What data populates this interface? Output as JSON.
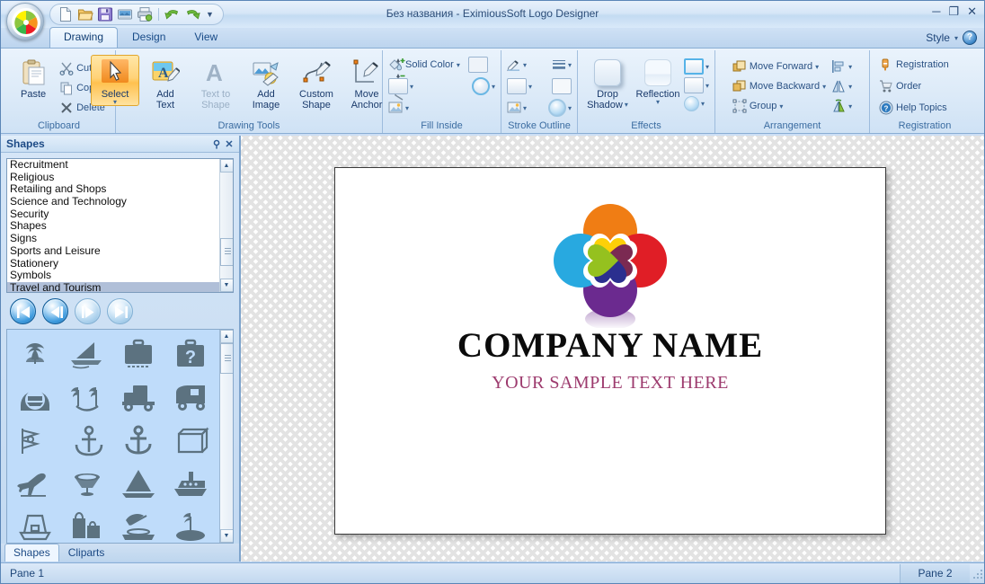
{
  "window": {
    "title": "Без названия - EximiousSoft Logo Designer",
    "minimize": "─",
    "maximize": "❐",
    "close": "✕"
  },
  "quick_access": {
    "items": [
      {
        "name": "new-document-icon",
        "tip": "New"
      },
      {
        "name": "open-folder-icon",
        "tip": "Open"
      },
      {
        "name": "save-disk-icon",
        "tip": "Save"
      },
      {
        "name": "export-image-icon",
        "tip": "Export"
      },
      {
        "name": "print-icon",
        "tip": "Print"
      },
      {
        "name": "undo-icon",
        "tip": "Undo"
      },
      {
        "name": "redo-icon",
        "tip": "Redo"
      }
    ],
    "customize_caret": "▼"
  },
  "ribbon": {
    "tabs": [
      {
        "label": "Drawing",
        "active": true
      },
      {
        "label": "Design",
        "active": false
      },
      {
        "label": "View",
        "active": false
      }
    ],
    "style_label": "Style",
    "style_caret": "▾",
    "help_glyph": "?",
    "groups": [
      {
        "title": "Clipboard",
        "paste_label": "Paste",
        "items": [
          {
            "label": "Cut",
            "icon": "scissors-icon"
          },
          {
            "label": "Copy",
            "icon": "copy-icon"
          },
          {
            "label": "Delete",
            "icon": "delete-x-icon"
          }
        ]
      },
      {
        "title": "Drawing Tools",
        "buttons": [
          {
            "label_top": "Select",
            "label_bottom": "",
            "icon": "cursor-arrow-icon",
            "selected": true,
            "has_caret": true,
            "disabled": false
          },
          {
            "label_top": "Add",
            "label_bottom": "Text",
            "icon": "add-text-icon",
            "selected": false,
            "has_caret": false,
            "disabled": false
          },
          {
            "label_top": "Text to",
            "label_bottom": "Shape",
            "icon": "text-to-shape-icon",
            "selected": false,
            "has_caret": false,
            "disabled": true
          },
          {
            "label_top": "Add",
            "label_bottom": "Image",
            "icon": "add-image-icon",
            "selected": false,
            "has_caret": false,
            "disabled": false
          },
          {
            "label_top": "Custom",
            "label_bottom": "Shape",
            "icon": "custom-shape-icon",
            "selected": false,
            "has_caret": false,
            "disabled": false
          },
          {
            "label_top": "Move",
            "label_bottom": "Anchor",
            "icon": "move-anchor-icon",
            "selected": false,
            "has_caret": false,
            "disabled": false
          }
        ],
        "mini_tools": [
          {
            "icon": "add-anchor-icon"
          },
          {
            "icon": "remove-anchor-icon"
          },
          {
            "icon": "corner-anchor-icon"
          }
        ]
      },
      {
        "title": "Fill Inside",
        "fill_type_label": "Solid Color",
        "fill_caret": "▾",
        "rows": [
          {
            "icon": "paint-bucket-icon",
            "label": "Solid Color"
          },
          {
            "icon": "gradient-swatch-icon",
            "label": ""
          },
          {
            "icon": "texture-image-icon",
            "label": ""
          }
        ]
      },
      {
        "title": "Stroke Outline",
        "rows": [
          {
            "icon": "pen-outline-icon"
          },
          {
            "icon": "line-weight-icon"
          },
          {
            "icon": "stroke-color-icon"
          },
          {
            "icon": "stroke-texture-icon"
          }
        ]
      },
      {
        "title": "Effects",
        "buttons": [
          {
            "label_top": "Drop",
            "label_bottom": "Shadow",
            "icon": "drop-shadow-icon",
            "has_caret": true
          },
          {
            "label_top": "Reflection",
            "label_bottom": "",
            "icon": "reflection-icon",
            "has_caret": true
          }
        ],
        "mini": [
          {
            "icon": "glow-effect-icon"
          },
          {
            "icon": "bevel-effect-icon"
          },
          {
            "icon": "soft-edge-icon"
          }
        ]
      },
      {
        "title": "Arrangement",
        "items": [
          {
            "label": "Move Forward",
            "icon": "move-forward-icon",
            "caret": "▾"
          },
          {
            "label": "Move Backward",
            "icon": "move-backward-icon",
            "caret": "▾"
          },
          {
            "label": "Group",
            "icon": "group-icon",
            "caret": "▾"
          }
        ],
        "mini": [
          {
            "icon": "align-icon",
            "caret": "▾"
          },
          {
            "icon": "flip-horizontal-icon",
            "caret": "▾"
          },
          {
            "icon": "rotate-icon",
            "caret": "▾"
          }
        ]
      },
      {
        "title": "Registration",
        "items": [
          {
            "label": "Registration",
            "icon": "registration-key-icon"
          },
          {
            "label": "Order",
            "icon": "shopping-cart-icon"
          },
          {
            "label": "Help Topics",
            "icon": "help-circle-icon"
          }
        ]
      }
    ]
  },
  "shapes_panel": {
    "title": "Shapes",
    "pin_glyph": "⚲",
    "close_glyph": "✕",
    "categories": [
      "Recruitment",
      "Religious",
      "Retailing and Shops",
      "Science and Technology",
      "Security",
      "Shapes",
      "Signs",
      "Sports and Leisure",
      "Stationery",
      "Symbols",
      "Travel and Tourism"
    ],
    "selected_category": "Travel and Tourism",
    "scroll_up_glyph": "▲",
    "scroll_down_glyph": "▼",
    "nav_buttons": [
      {
        "name": "first-page-button",
        "glyph": "first",
        "enabled": true
      },
      {
        "name": "previous-page-button",
        "glyph": "prev",
        "enabled": true
      },
      {
        "name": "next-page-button",
        "glyph": "next",
        "enabled": false
      },
      {
        "name": "last-page-button",
        "glyph": "last",
        "enabled": false
      }
    ],
    "thumbnails": [
      "palm-island-icon",
      "sailboat-icon",
      "suitcase-icon",
      "question-suitcase-icon",
      "cruise-badge-icon",
      "two-palms-icon",
      "vintage-car-icon",
      "bus-icon",
      "nautical-flags-icon",
      "anchor-rope-icon",
      "anchor-icon",
      "shopping-bag-icon",
      "airplane-icon",
      "fountain-icon",
      "sail-triangle-icon",
      "ship-icon",
      "fishing-boat-icon",
      "travel-bags-icon",
      "beach-umbrella-icon",
      "palm-beach-icon"
    ],
    "bottom_tabs": [
      {
        "label": "Shapes",
        "active": true
      },
      {
        "label": "Cliparts",
        "active": false
      }
    ]
  },
  "canvas": {
    "logo": {
      "company_name": "COMPANY NAME",
      "sample_text": "YOUR SAMPLE TEXT HERE",
      "petal_colors": [
        "#f07d14",
        "#e01e26",
        "#6b2a8f",
        "#28a9e0"
      ],
      "heart_colors": [
        "#fdd008",
        "#7b2a52",
        "#2b2f8f",
        "#95c11f"
      ],
      "name_color": "#0b0b0b",
      "sample_color": "#9d3b6e"
    }
  },
  "statusbar": {
    "pane1": "Pane 1",
    "pane2": "Pane 2"
  }
}
